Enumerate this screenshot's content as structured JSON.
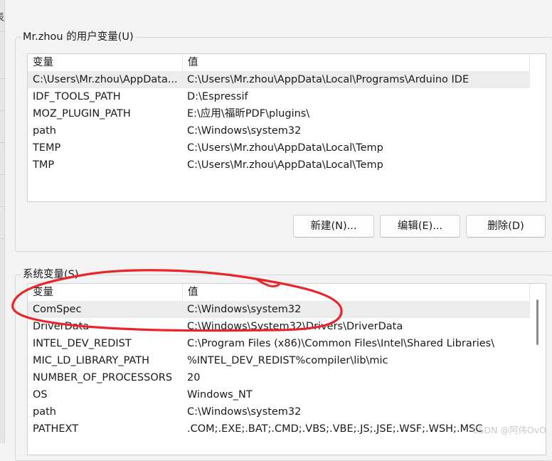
{
  "left_strip": {
    "char": "表"
  },
  "user_vars": {
    "title": "Mr.zhou 的用户变量(U)",
    "columns": {
      "name": "变量",
      "value": "值"
    },
    "rows": [
      {
        "name": "C:\\Users\\Mr.zhou\\AppData...",
        "value": "C:\\Users\\Mr.zhou\\AppData\\Local\\Programs\\Arduino IDE"
      },
      {
        "name": "IDF_TOOLS_PATH",
        "value": "D:\\Espressif"
      },
      {
        "name": "MOZ_PLUGIN_PATH",
        "value": "E:\\应用\\福昕PDF\\plugins\\"
      },
      {
        "name": "path",
        "value": "C:\\Windows\\system32"
      },
      {
        "name": "TEMP",
        "value": "C:\\Users\\Mr.zhou\\AppData\\Local\\Temp"
      },
      {
        "name": "TMP",
        "value": "C:\\Users\\Mr.zhou\\AppData\\Local\\Temp"
      }
    ],
    "buttons": {
      "new": "新建(N)...",
      "edit": "编辑(E)...",
      "delete": "删除(D)"
    }
  },
  "system_vars": {
    "title": "系统变量(S)",
    "columns": {
      "name": "变量",
      "value": "值"
    },
    "rows": [
      {
        "name": "ComSpec",
        "value": "C:\\Windows\\system32"
      },
      {
        "name": "DriverData",
        "value": "C:\\Windows\\System32\\Drivers\\DriverData"
      },
      {
        "name": "INTEL_DEV_REDIST",
        "value": "C:\\Program Files (x86)\\Common Files\\Intel\\Shared Libraries\\"
      },
      {
        "name": "MIC_LD_LIBRARY_PATH",
        "value": "%INTEL_DEV_REDIST%compiler\\lib\\mic"
      },
      {
        "name": "NUMBER_OF_PROCESSORS",
        "value": "20"
      },
      {
        "name": "OS",
        "value": "Windows_NT"
      },
      {
        "name": "path",
        "value": "C:\\Windows\\system32"
      },
      {
        "name": "PATHEXT",
        "value": ".COM;.EXE;.BAT;.CMD;.VBS;.VBE;.JS;.JSE;.WSF;.WSH;.MSC"
      }
    ]
  },
  "watermark": "CSDN @阿伟OvO",
  "colors": {
    "annotation": "#e8262a",
    "selected_row": "#ececec",
    "background": "#f3f3f3"
  }
}
